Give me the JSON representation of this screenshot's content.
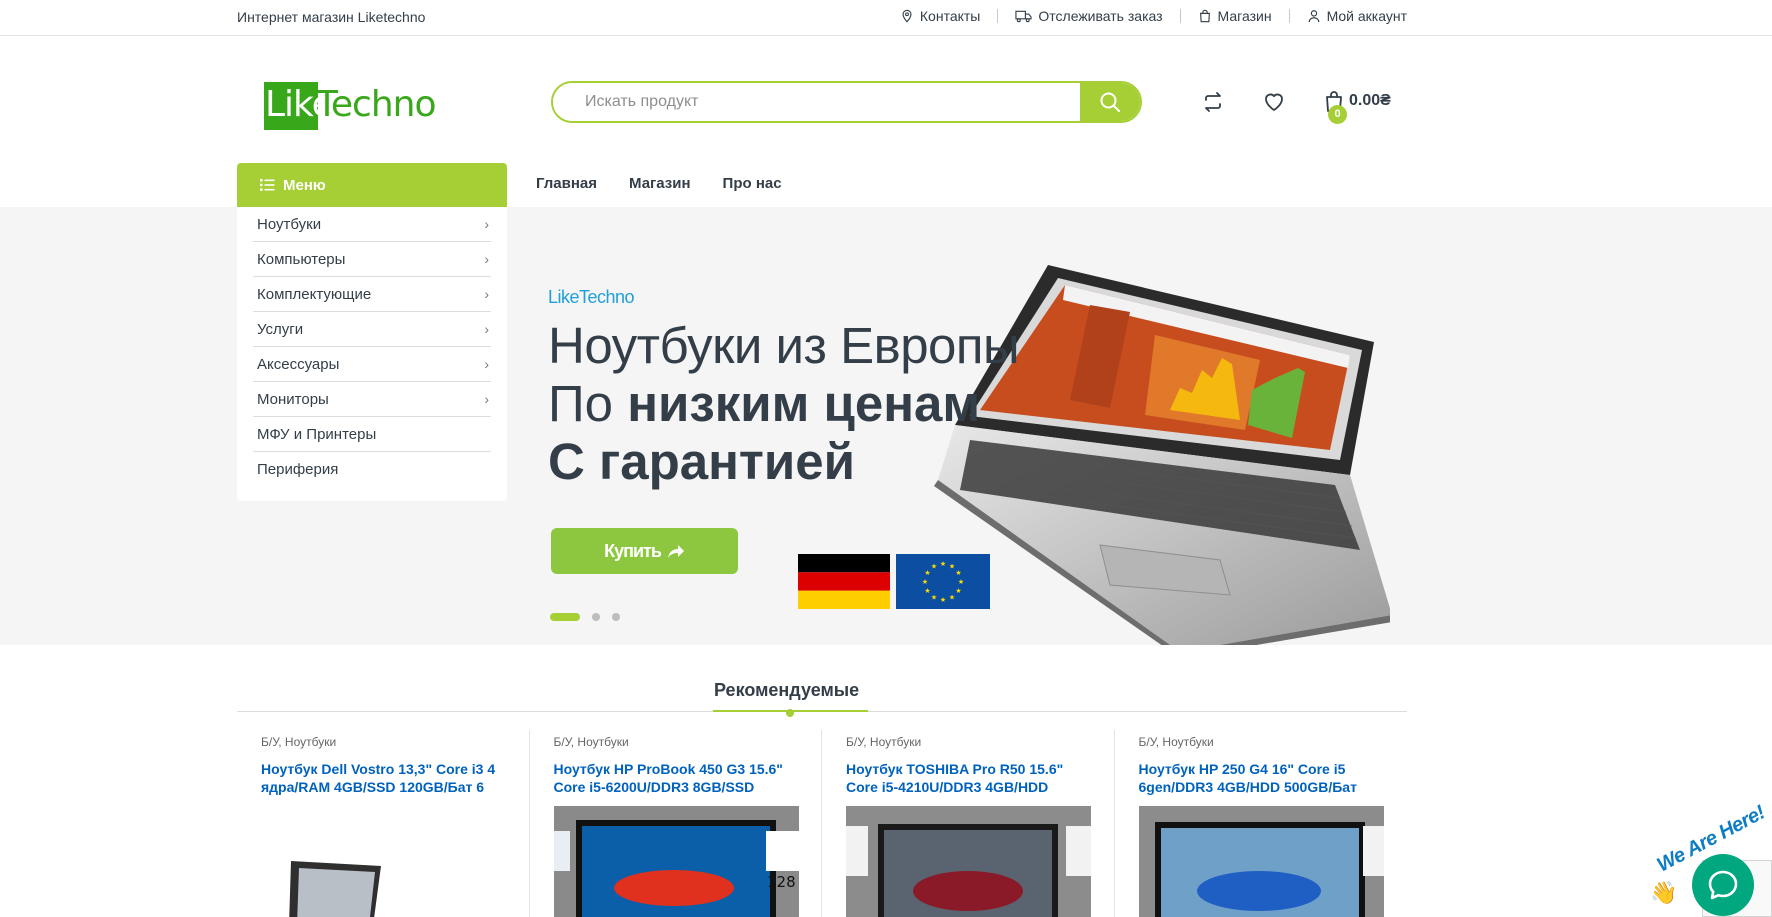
{
  "topbar": {
    "welcome": "Интернет магазин Liketechno",
    "links": {
      "contacts": "Контакты",
      "track": "Отслеживать заказ",
      "shop": "Магазин",
      "account": "Мой аккаунт"
    }
  },
  "header": {
    "logo_like": "Like",
    "logo_techno": "Techno",
    "search_placeholder": "Искать продукт",
    "cart_count": "0",
    "cart_total": "0.00₴"
  },
  "nav": {
    "menu_label": "Меню",
    "items": [
      "Главная",
      "Магазин",
      "Про нас"
    ]
  },
  "categories": [
    {
      "label": "Ноутбуки",
      "chevron": true
    },
    {
      "label": "Компьютеры",
      "chevron": true
    },
    {
      "label": "Комплектующие",
      "chevron": true
    },
    {
      "label": "Услуги",
      "chevron": true
    },
    {
      "label": "Аксессуары",
      "chevron": true
    },
    {
      "label": "Мониторы",
      "chevron": true
    },
    {
      "label": "МФУ и Принтеры",
      "chevron": false
    },
    {
      "label": "Периферия",
      "chevron": false
    }
  ],
  "hero": {
    "brand": "LikeTechno",
    "line1": "Ноутбуки из Европы",
    "line2_prefix": "По ",
    "line2_bold": "низким ценам",
    "line3": "С гарантией",
    "buy_label": "Купить",
    "active_slide": 1,
    "slide_count": 3
  },
  "recommended": {
    "title": "Рекомендуемые",
    "products": [
      {
        "category": "Б/У, Ноутбуки",
        "name": "Ноутбук Dell Vostro 13,3\" Core i3 4 ядра/RAM 4GB/SSD 120GB/Бат 6",
        "car_color": "#c9cdd2"
      },
      {
        "category": "Б/У, Ноутбуки",
        "name": "Ноутбук HP ProBook 450 G3 15.6\" Core i5-6200U/DDR3 8GB/SSD",
        "car_color": "#e0301e"
      },
      {
        "category": "Б/У, Ноутбуки",
        "name": "Ноутбук TOSHIBA Pro R50 15.6\" Core i5-4210U/DDR3 4GB/HDD",
        "car_color": "#8a1a28"
      },
      {
        "category": "Б/У, Ноутбуки",
        "name": "Ноутбук HP 250 G4 16\" Core i5 6gen/DDR3 4GB/HDD 500GB/Бат",
        "car_color": "#1f5fc4"
      }
    ]
  },
  "chat": {
    "label": "We Are Here!"
  },
  "colors": {
    "accent": "#a5cf35",
    "logo_green": "#38a71a",
    "link_blue": "#0062bd",
    "brand_blue": "#1fa0d8",
    "chat_green": "#00a77f"
  }
}
